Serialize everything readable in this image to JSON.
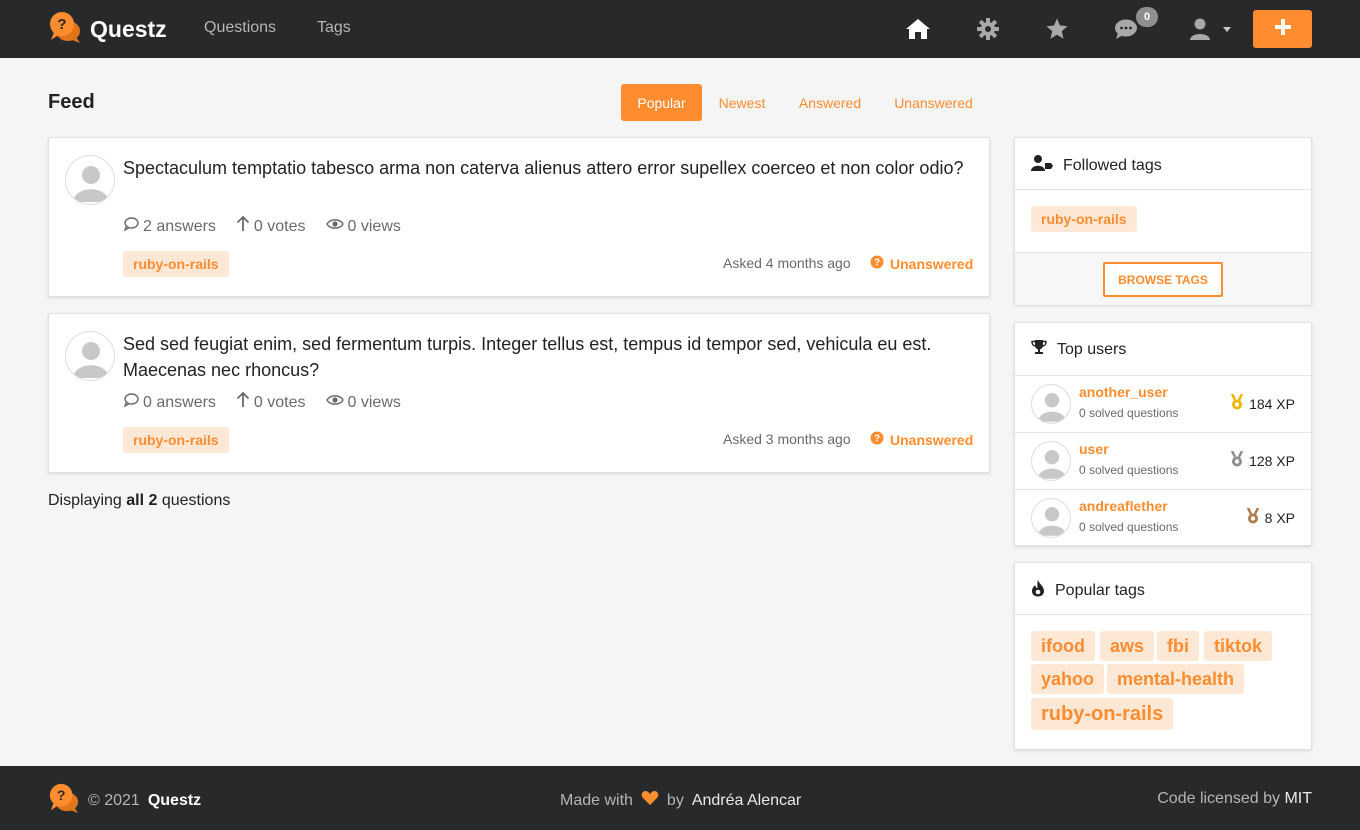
{
  "app": {
    "name": "Questz",
    "nav_links": [
      "Questions",
      "Tags"
    ],
    "messages_count": "0",
    "accent": "#ff8c2f",
    "icons": [
      "home-icon",
      "gear-icon",
      "star-icon",
      "comments-icon",
      "user-icon",
      "plus-icon"
    ]
  },
  "feed": {
    "title": "Feed",
    "tabs": [
      "Popular",
      "Newest",
      "Answered",
      "Unanswered"
    ],
    "active_tab": "Popular",
    "questions": [
      {
        "title": "Spectaculum temptatio tabesco arma non caterva alienus attero error supellex coerceo et non color odio?",
        "answers": "2 answers",
        "votes": "0 votes",
        "views": "0 views",
        "tag": "ruby-on-rails",
        "asked": "Asked 4 months ago",
        "status": "Unanswered"
      },
      {
        "title": "Sed sed feugiat enim, sed fermentum turpis. Integer tellus est, tempus id tempor sed, vehicula eu est. Maecenas nec rhoncus?",
        "answers": "0 answers",
        "votes": "0 votes",
        "views": "0 views",
        "tag": "ruby-on-rails",
        "asked": "Asked 3 months ago",
        "status": "Unanswered"
      }
    ],
    "display_prefix": "Displaying",
    "display_bold": "all 2",
    "display_suffix": "questions"
  },
  "sidebar": {
    "followed": {
      "title": "Followed tags",
      "tags": [
        "ruby-on-rails"
      ],
      "browse_label": "BROWSE TAGS"
    },
    "top_users": {
      "title": "Top users",
      "users": [
        {
          "name": "another_user",
          "sub": "0 solved questions",
          "xp": "184 XP",
          "medal_color": "#f0b400"
        },
        {
          "name": "user",
          "sub": "0 solved questions",
          "xp": "128 XP",
          "medal_color": "#8e8e8e"
        },
        {
          "name": "andreaflether",
          "sub": "0 solved questions",
          "xp": "8 XP",
          "medal_color": "#b07a4a"
        }
      ]
    },
    "popular_tags": {
      "title": "Popular tags",
      "tags": [
        "ifood",
        "aws",
        "fbi",
        "tiktok",
        "yahoo",
        "mental-health",
        "ruby-on-rails"
      ]
    }
  },
  "footer": {
    "copyright": "© 2021",
    "brand": "Questz",
    "made_with": "Made with",
    "by": "by",
    "author": "Andréa Alencar",
    "license_prefix": "Code licensed by",
    "license": "MIT"
  }
}
